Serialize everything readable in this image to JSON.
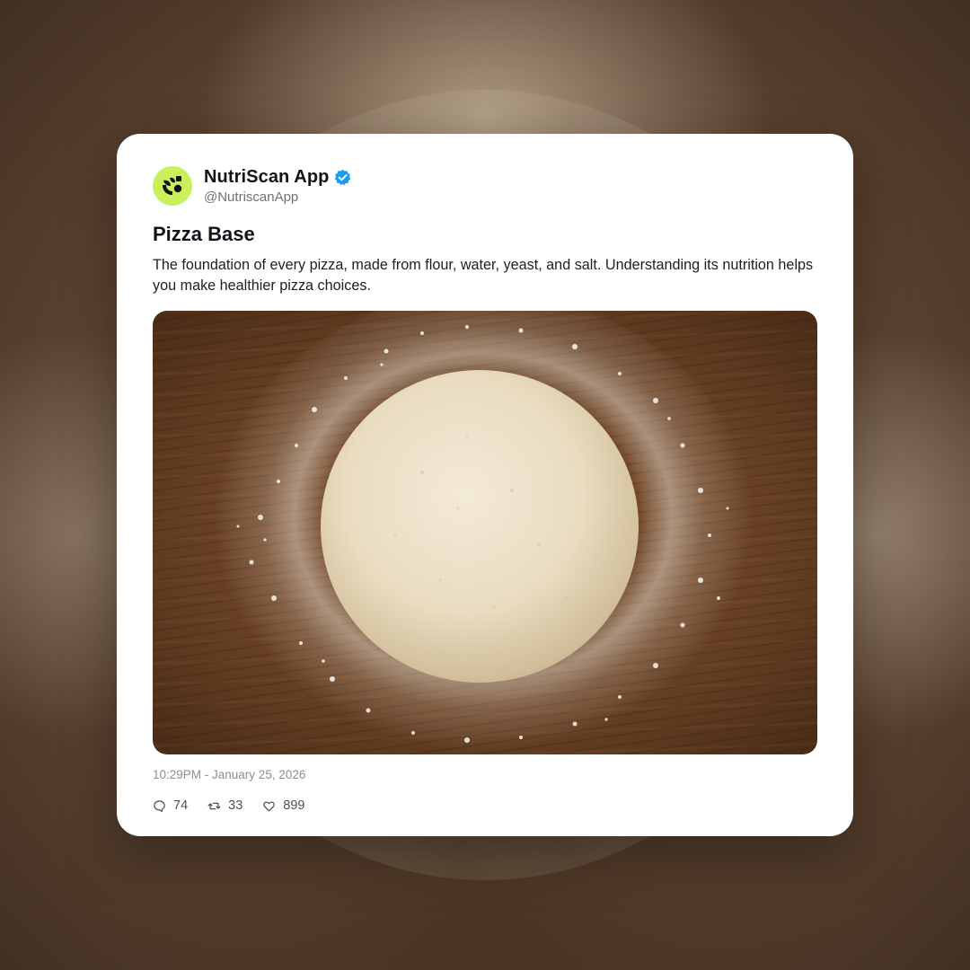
{
  "post": {
    "author_name": "NutriScan App",
    "author_handle": "@NutriscanApp",
    "verified": true,
    "avatar_icon": "leaf-scan-logo-icon",
    "title": "Pizza Base",
    "body": "The foundation of every pizza, made from flour, water, yeast, and salt. Understanding its nutrition helps you make healthier pizza choices.",
    "image_subject": "dough-ball-photo",
    "timestamp": "10:29PM - January 25, 2026",
    "stats": {
      "replies": "74",
      "retweets": "33",
      "likes": "899"
    }
  },
  "colors": {
    "avatar_bg": "#c9ef5a",
    "verified_badge": "#1d9bf0",
    "card_bg": "#ffffff",
    "text_primary": "#0f1419",
    "text_muted": "#8a8f95"
  },
  "icons": {
    "verified": "verified-badge-icon",
    "reply": "reply-icon",
    "retweet": "retweet-icon",
    "like": "heart-icon"
  }
}
